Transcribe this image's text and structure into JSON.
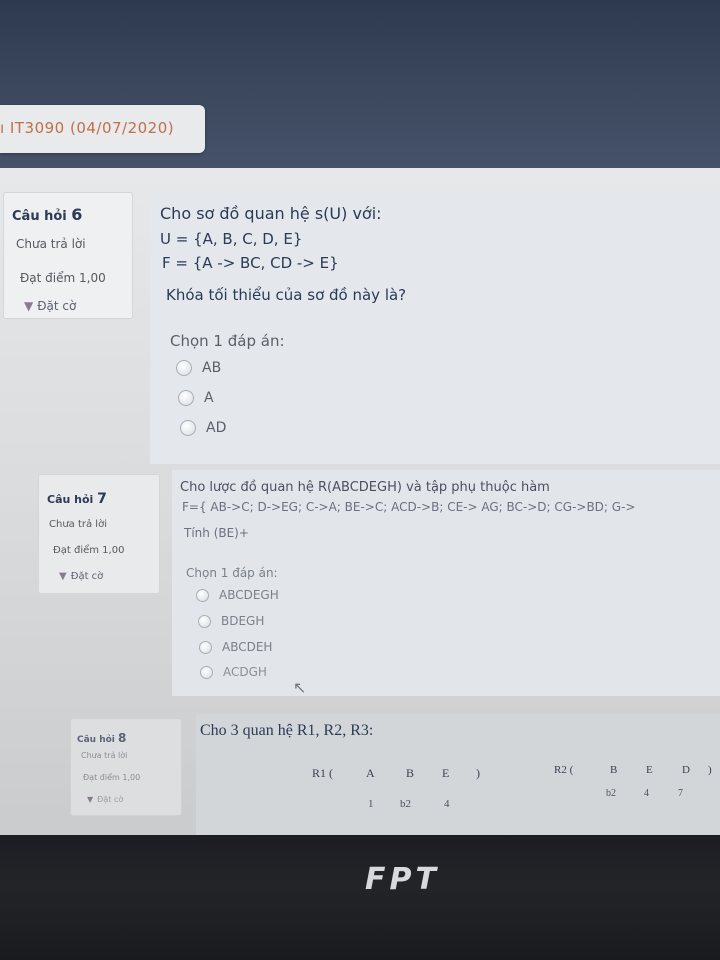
{
  "header": {
    "course_title": "ı IT3090 (04/07/2020)"
  },
  "questions": [
    {
      "label": "Câu hỏi",
      "number": "6",
      "status": "Chưa trả lời",
      "score": "Đạt điểm 1,00",
      "flag_label": "Đặt cờ",
      "lines": [
        "Cho sơ đồ quan hệ s(U) với:",
        "U = {A, B, C, D, E}",
        "F = {A -> BC, CD -> E}"
      ],
      "question": "Khóa tối thiểu của sơ đồ này là?",
      "prompt": "Chọn 1 đáp án:",
      "options": [
        "AB",
        "A",
        "AD"
      ]
    },
    {
      "label": "Câu hỏi",
      "number": "7",
      "status": "Chưa trả lời",
      "score": "Đạt điểm 1,00",
      "flag_label": "Đặt cờ",
      "lines": [
        "Cho lược đồ quan hệ R(ABCDEGH) và tập phụ thuộc hàm",
        "F={ AB->C; D->EG; C->A; BE->C; ACD->B; CE-> AG; BC->D; CG->BD; G->",
        "Tính (BE)+"
      ],
      "prompt": "Chọn 1 đáp án:",
      "options": [
        "ABCDEGH",
        "BDEGH",
        "ABCDEH",
        "ACDGH"
      ]
    },
    {
      "label": "Câu hỏi",
      "number": "8",
      "status": "Chưa trả lời",
      "score": "Đạt điểm 1,00",
      "flag_label": "Đặt cờ",
      "lines": [
        "Cho 3 quan hệ R1, R2, R3:"
      ],
      "r1": {
        "head": [
          "R1 (",
          "A",
          "B",
          "E",
          ")"
        ],
        "row": [
          "1",
          "b2",
          "4"
        ]
      },
      "r2": {
        "head": [
          "R2 (",
          "B",
          "E",
          "D",
          ")"
        ],
        "row": [
          "b2",
          "4",
          "7"
        ]
      }
    }
  ],
  "monitor": {
    "brand": "FPT"
  },
  "colors": {
    "accent_tab": "#c0704a",
    "question_text": "#2b3a55"
  }
}
